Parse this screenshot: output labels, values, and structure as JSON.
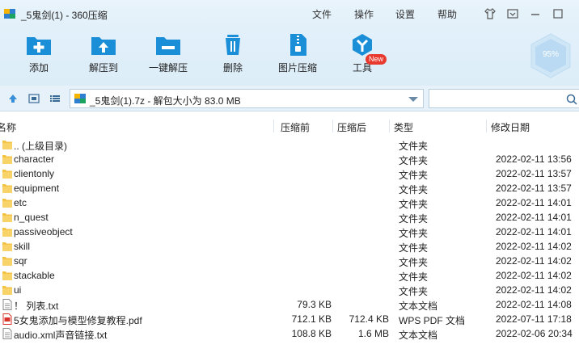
{
  "window": {
    "title": "_5鬼剑(1) - 360压缩"
  },
  "menu": {
    "file": "文件",
    "edit": "操作",
    "settings": "设置",
    "help": "帮助"
  },
  "toolbar": {
    "add": "添加",
    "extract_to": "解压到",
    "one_click": "一键解压",
    "delete": "删除",
    "image_compress": "图片压缩",
    "tools": "工具",
    "tools_badge": "New"
  },
  "perf": {
    "value": "95%"
  },
  "address": {
    "path": "_5鬼剑(1).7z - 解包大小为 83.0 MB",
    "search_placeholder": ""
  },
  "columns": {
    "name": "名称",
    "packed": "压缩前",
    "unpacked": "压缩后",
    "type": "类型",
    "modified": "修改日期"
  },
  "files": [
    {
      "name": ".. (上级目录)",
      "packed": "",
      "unpacked": "",
      "type": "文件夹",
      "date": "",
      "icon": "folder"
    },
    {
      "name": "character",
      "packed": "",
      "unpacked": "",
      "type": "文件夹",
      "date": "2022-02-11 13:56",
      "icon": "folder"
    },
    {
      "name": "clientonly",
      "packed": "",
      "unpacked": "",
      "type": "文件夹",
      "date": "2022-02-11 13:57",
      "icon": "folder"
    },
    {
      "name": "equipment",
      "packed": "",
      "unpacked": "",
      "type": "文件夹",
      "date": "2022-02-11 13:57",
      "icon": "folder"
    },
    {
      "name": "etc",
      "packed": "",
      "unpacked": "",
      "type": "文件夹",
      "date": "2022-02-11 14:01",
      "icon": "folder"
    },
    {
      "name": "n_quest",
      "packed": "",
      "unpacked": "",
      "type": "文件夹",
      "date": "2022-02-11 14:01",
      "icon": "folder"
    },
    {
      "name": "passiveobject",
      "packed": "",
      "unpacked": "",
      "type": "文件夹",
      "date": "2022-02-11 14:01",
      "icon": "folder"
    },
    {
      "name": "skill",
      "packed": "",
      "unpacked": "",
      "type": "文件夹",
      "date": "2022-02-11 14:02",
      "icon": "folder"
    },
    {
      "name": "sqr",
      "packed": "",
      "unpacked": "",
      "type": "文件夹",
      "date": "2022-02-11 14:02",
      "icon": "folder"
    },
    {
      "name": "stackable",
      "packed": "",
      "unpacked": "",
      "type": "文件夹",
      "date": "2022-02-11 14:02",
      "icon": "folder"
    },
    {
      "name": "ui",
      "packed": "",
      "unpacked": "",
      "type": "文件夹",
      "date": "2022-02-11 14:02",
      "icon": "folder"
    },
    {
      "name": "！ 列表.txt",
      "packed": "79.3 KB",
      "unpacked": "",
      "type": "文本文档",
      "date": "2022-02-11 14:08",
      "icon": "txt"
    },
    {
      "name": "5女鬼添加与模型修复教程.pdf",
      "packed": "712.1 KB",
      "unpacked": "712.4 KB",
      "type": "WPS PDF 文档",
      "date": "2022-07-11 17:18",
      "icon": "pdf"
    },
    {
      "name": "audio.xml声音链接.txt",
      "packed": "108.8 KB",
      "unpacked": "1.6 MB",
      "type": "文本文档",
      "date": "2022-02-06 20:34",
      "icon": "txt"
    }
  ],
  "colors": {
    "accent": "#1a8fd8",
    "folder": "#f5c342",
    "toolbar_bg": "#e2f0fa",
    "pdf": "#d9342b"
  }
}
